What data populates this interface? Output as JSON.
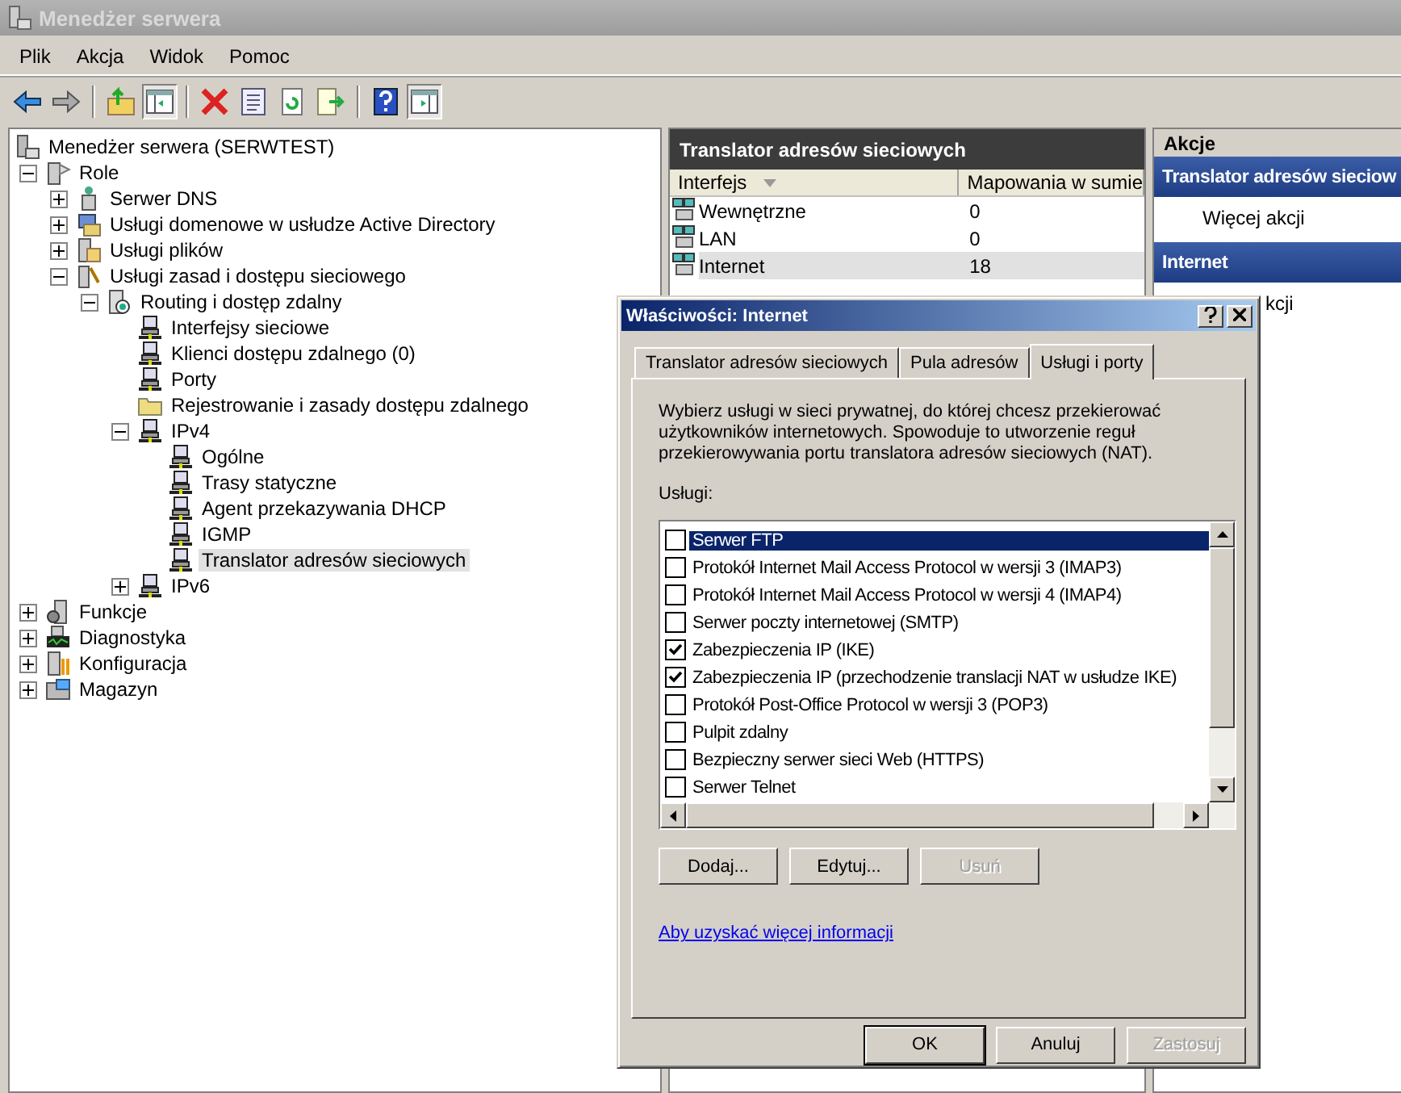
{
  "window": {
    "title": "Menedżer serwera"
  },
  "menu": [
    "Plik",
    "Akcja",
    "Widok",
    "Pomoc"
  ],
  "toolbar": [
    {
      "kind": "back",
      "pressed": false
    },
    {
      "kind": "forward",
      "pressed": false
    },
    {
      "kind": "sep"
    },
    {
      "kind": "up",
      "pressed": false
    },
    {
      "kind": "tree",
      "pressed": true
    },
    {
      "kind": "sep"
    },
    {
      "kind": "delete",
      "pressed": false
    },
    {
      "kind": "properties",
      "pressed": false
    },
    {
      "kind": "refresh",
      "pressed": false
    },
    {
      "kind": "export",
      "pressed": false
    },
    {
      "kind": "sep"
    },
    {
      "kind": "help",
      "pressed": false
    },
    {
      "kind": "actionpane",
      "pressed": true
    }
  ],
  "tree": [
    {
      "label": "Menedżer serwera (SERWTEST)",
      "kind": "server",
      "selected": false
    },
    {
      "label": "Role",
      "kind": "roles",
      "expanded": true,
      "selected": false,
      "children": [
        {
          "label": "Serwer DNS",
          "kind": "dns",
          "expanded": false,
          "selected": false
        },
        {
          "label": "Usługi domenowe w usłudze Active Directory",
          "kind": "ad",
          "expanded": false,
          "selected": false
        },
        {
          "label": "Usługi plików",
          "kind": "files",
          "expanded": false,
          "selected": false
        },
        {
          "label": "Usługi zasad i dostępu sieciowego",
          "kind": "policy",
          "expanded": true,
          "selected": false,
          "children": [
            {
              "label": "Routing i dostęp zdalny",
              "kind": "routing",
              "expanded": true,
              "selected": false,
              "children": [
                {
                  "label": "Interfejsy sieciowe",
                  "kind": "network",
                  "selected": false
                },
                {
                  "label": "Klienci dostępu zdalnego (0)",
                  "kind": "network",
                  "selected": false
                },
                {
                  "label": "Porty",
                  "kind": "network",
                  "selected": false
                },
                {
                  "label": "Rejestrowanie i zasady dostępu zdalnego",
                  "kind": "folder",
                  "selected": false
                },
                {
                  "label": "IPv4",
                  "kind": "network",
                  "expanded": true,
                  "selected": false,
                  "children": [
                    {
                      "label": "Ogólne",
                      "kind": "network",
                      "selected": false
                    },
                    {
                      "label": "Trasy statyczne",
                      "kind": "network",
                      "selected": false
                    },
                    {
                      "label": "Agent przekazywania DHCP",
                      "kind": "network",
                      "selected": false
                    },
                    {
                      "label": "IGMP",
                      "kind": "network",
                      "selected": false
                    },
                    {
                      "label": "Translator adresów sieciowych",
                      "kind": "network",
                      "selected": true
                    }
                  ]
                },
                {
                  "label": "IPv6",
                  "kind": "network",
                  "expanded": false,
                  "selected": false
                }
              ]
            }
          ]
        }
      ]
    },
    {
      "label": "Funkcje",
      "kind": "functions",
      "expanded": false,
      "selected": false
    },
    {
      "label": "Diagnostyka",
      "kind": "diagnostics",
      "expanded": false,
      "selected": false
    },
    {
      "label": "Konfiguracja",
      "kind": "config",
      "expanded": false,
      "selected": false
    },
    {
      "label": "Magazyn",
      "kind": "storage",
      "expanded": false,
      "selected": false
    }
  ],
  "center": {
    "title": "Translator adresów sieciowych",
    "columns": [
      "Interfejs",
      "Mapowania w sumie"
    ],
    "rows": [
      {
        "name": "Wewnętrzne",
        "mappings": "0",
        "selected": false
      },
      {
        "name": "LAN",
        "mappings": "0",
        "selected": false
      },
      {
        "name": "Internet",
        "mappings": "18",
        "selected": true
      }
    ]
  },
  "actions": {
    "title": "Akcje",
    "sections": [
      {
        "title": "Translator adresów sieciow",
        "items": [
          "Więcej akcji"
        ]
      },
      {
        "title": "Internet",
        "items": [
          "kcji"
        ]
      }
    ]
  },
  "dialog": {
    "title": "Właściwości: Internet",
    "tabs": [
      {
        "label": "Translator adresów sieciowych",
        "selected": false
      },
      {
        "label": "Pula adresów",
        "selected": false
      },
      {
        "label": "Usługi i porty",
        "selected": true
      }
    ],
    "description": "Wybierz usługi w sieci prywatnej, do której chcesz przekierować użytkowników internetowych. Spowoduje to utworzenie reguł przekierowywania portu translatora adresów sieciowych (NAT).",
    "services_label": "Usługi:",
    "services": [
      {
        "label": "Serwer FTP",
        "checked": false,
        "selected": true
      },
      {
        "label": "Protokół Internet Mail Access Protocol w wersji 3 (IMAP3)",
        "checked": false,
        "selected": false
      },
      {
        "label": "Protokół Internet Mail Access Protocol w wersji 4 (IMAP4)",
        "checked": false,
        "selected": false
      },
      {
        "label": "Serwer poczty internetowej (SMTP)",
        "checked": false,
        "selected": false
      },
      {
        "label": "Zabezpieczenia IP (IKE)",
        "checked": true,
        "selected": false
      },
      {
        "label": "Zabezpieczenia IP (przechodzenie translacji NAT w usłudze IKE)",
        "checked": true,
        "selected": false
      },
      {
        "label": "Protokół Post-Office Protocol w wersji 3 (POP3)",
        "checked": false,
        "selected": false
      },
      {
        "label": "Pulpit zdalny",
        "checked": false,
        "selected": false
      },
      {
        "label": "Bezpieczny serwer sieci Web (HTTPS)",
        "checked": false,
        "selected": false
      },
      {
        "label": "Serwer Telnet",
        "checked": false,
        "selected": false
      }
    ],
    "list_buttons": [
      {
        "label": "Dodaj...",
        "disabled": false
      },
      {
        "label": "Edytuj...",
        "disabled": false
      },
      {
        "label": "Usuń",
        "disabled": true
      }
    ],
    "link": "Aby uzyskać więcej informacji",
    "buttons": [
      {
        "label": "OK",
        "disabled": false,
        "default": true
      },
      {
        "label": "Anuluj",
        "disabled": false,
        "default": false
      },
      {
        "label": "Zastosuj",
        "disabled": true,
        "default": false
      }
    ]
  }
}
